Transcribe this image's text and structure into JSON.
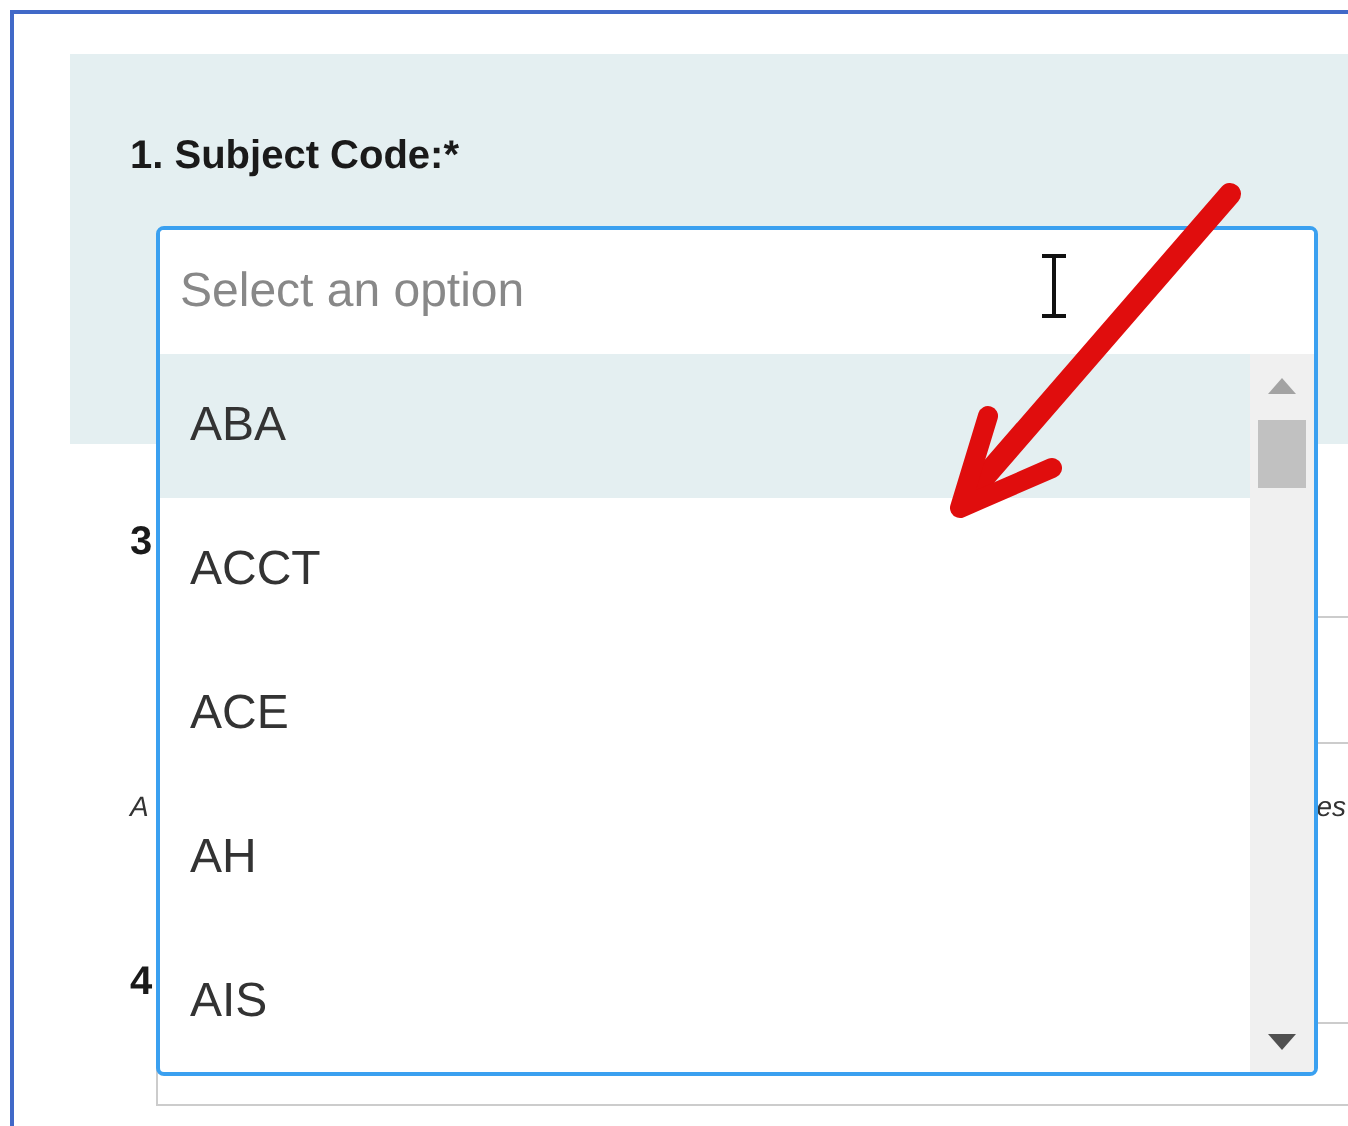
{
  "form": {
    "question_1": {
      "label": "1. Subject Code:*",
      "dropdown": {
        "placeholder": "Select an option",
        "options": [
          {
            "label": "ABA",
            "selected": true
          },
          {
            "label": "ACCT",
            "selected": false
          },
          {
            "label": "ACE",
            "selected": false
          },
          {
            "label": "AH",
            "selected": false
          },
          {
            "label": "AIS",
            "selected": false
          }
        ]
      }
    },
    "question_3": {
      "number": "3"
    },
    "note": {
      "start": "A",
      "end": "es"
    },
    "question_4": {
      "number": "4"
    }
  }
}
